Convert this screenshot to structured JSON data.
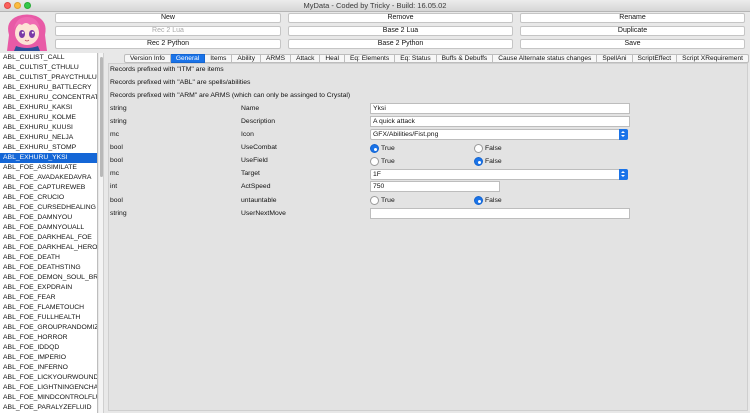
{
  "window": {
    "title": "MyData - Coded by Tricky - Build: 16.05.02"
  },
  "toolbar": {
    "new": "New",
    "remove": "Remove",
    "rename": "Rename",
    "rec2lua": "Rec 2 Lua",
    "base2lua": "Base 2 Lua",
    "duplicate": "Duplicate",
    "rec2python": "Rec 2 Python",
    "base2python": "Base 2 Python",
    "save": "Save"
  },
  "records": [
    "ABL_CULIST_CALL",
    "ABL_CULTIST_CTHULU",
    "ABL_CULTIST_PRAYCTHULU",
    "ABL_EXHURU_BATTLECRY",
    "ABL_EXHURU_CONCENTRATE",
    "ABL_EXHURU_KAKSI",
    "ABL_EXHURU_KOLME",
    "ABL_EXHURU_KUUSI",
    "ABL_EXHURU_NELJA",
    "ABL_EXHURU_STOMP",
    "ABL_EXHURU_YKSI",
    "ABL_FOE_ASSIMILATE",
    "ABL_FOE_AVADAKEDAVRA",
    "ABL_FOE_CAPTUREWEB",
    "ABL_FOE_CRUCIO",
    "ABL_FOE_CURSEDHEALING",
    "ABL_FOE_DAMNYOU",
    "ABL_FOE_DAMNYOUALL",
    "ABL_FOE_DARKHEAL_FOE",
    "ABL_FOE_DARKHEAL_HERO",
    "ABL_FOE_DEATH",
    "ABL_FOE_DEATHSTING",
    "ABL_FOE_DEMON_SOUL_BREAK",
    "ABL_FOE_EXPDRAIN",
    "ABL_FOE_FEAR",
    "ABL_FOE_FLAMETOUCH",
    "ABL_FOE_FULLHEALTH",
    "ABL_FOE_GROUPRANDOMIZER",
    "ABL_FOE_HORROR",
    "ABL_FOE_IDDQD",
    "ABL_FOE_IMPERIO",
    "ABL_FOE_INFERNO",
    "ABL_FOE_LICKYOURWOUNDS",
    "ABL_FOE_LIGHTNINGENCHANT",
    "ABL_FOE_MINDCONTROLFLUID",
    "ABL_FOE_PARALYZEFLUID"
  ],
  "selected_record": "ABL_EXHURU_YKSI",
  "tabs": [
    "Version Info",
    "General",
    "Items",
    "Ability",
    "ARMS",
    "Attack",
    "Heal",
    "Eq: Elements",
    "Eq: Status",
    "Buffs & Debuffs",
    "Cause Alternate status changes",
    "SpellAni",
    "ScriptEffect",
    "Script XRequirement"
  ],
  "active_tab": "General",
  "notes": [
    "Records prefixed with \"ITM\" are items",
    "Records prefixed with \"ABL\" are spells/abilities",
    "Records prefixed with \"ARM\" are ARMS (which can only be assinged to Crystal)"
  ],
  "fields": [
    {
      "type": "string",
      "name": "Name",
      "value": "Yksi"
    },
    {
      "type": "string",
      "name": "Description",
      "value": "A quick attack"
    },
    {
      "type": "mc",
      "name": "Icon",
      "value": "GFX/Abilities/Fist.png"
    },
    {
      "type": "bool",
      "name": "UseCombat",
      "value": "True"
    },
    {
      "type": "bool",
      "name": "UseField",
      "value": "False"
    },
    {
      "type": "mc",
      "name": "Target",
      "value": "1F"
    },
    {
      "type": "int",
      "name": "ActSpeed",
      "value": "750"
    },
    {
      "type": "bool",
      "name": "untauntable",
      "value": "False"
    },
    {
      "type": "string",
      "name": "UserNextMove",
      "value": ""
    }
  ],
  "radio_labels": {
    "true": "True",
    "false": "False"
  },
  "colors": {
    "accent": "#1a73e8",
    "selection": "#1466d6"
  }
}
